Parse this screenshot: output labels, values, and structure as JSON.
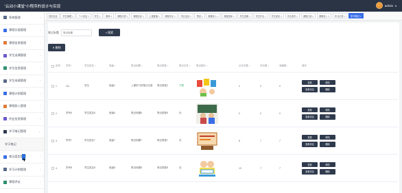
{
  "header": {
    "title": "“云动小课堂”小程序的设计与实现",
    "user": "admin",
    "caret": "▾"
  },
  "sidebar": {
    "items": [
      {
        "label": "系统管理",
        "arrow": "›"
      },
      {
        "label": "课程分类管理",
        "arrow": "›"
      },
      {
        "label": "课程信息管理",
        "arrow": "›"
      },
      {
        "label": "学生选课管理",
        "arrow": "›"
      },
      {
        "label": "学生信息管理",
        "arrow": "›"
      },
      {
        "label": "学生成绩管理",
        "arrow": "›"
      },
      {
        "label": "课程计划管理",
        "arrow": "›"
      },
      {
        "label": "课程收入管理",
        "arrow": "›"
      },
      {
        "label": "作业信息管理",
        "arrow": "›"
      },
      {
        "label": "学习笔记管理",
        "arrow": "⌄"
      },
      {
        "label": "学习笔记",
        "sub": true
      },
      {
        "label": "笔记类型管理",
        "arrow": "›"
      },
      {
        "label": "学习计划管理",
        "arrow": "›"
      },
      {
        "label": "课程评论",
        "arrow": "›"
      },
      {
        "label": "系统管理",
        "arrow": "›"
      }
    ]
  },
  "tabs": [
    {
      "label": "首页信息"
    },
    {
      "label": "学生管理 ×"
    },
    {
      "label": "个人信息 ×"
    },
    {
      "label": "学生 ×"
    },
    {
      "label": "教师 ×"
    },
    {
      "label": "课程分类 ×"
    },
    {
      "label": "课程信息 ×"
    },
    {
      "label": "上课直播 ×"
    },
    {
      "label": "课程评论 ×"
    },
    {
      "label": "作业信息 ×"
    },
    {
      "label": "预设 ×"
    },
    {
      "label": "课程收入 ×"
    },
    {
      "label": "课程选择 ×"
    },
    {
      "label": "学生选课 ×"
    },
    {
      "label": "学生作业 ×"
    },
    {
      "label": "学生成绩 ×"
    },
    {
      "label": "作业收件 ×"
    },
    {
      "label": "课程计划 ×"
    },
    {
      "label": "课程收入 ×"
    },
    {
      "label": "作业记录 ×"
    },
    {
      "label": "学习笔记 ×",
      "active": true
    }
  ],
  "search": {
    "label": "笔记标题",
    "placeholder": "笔记标题",
    "button": "搜索",
    "button_icon": "⌕"
  },
  "delete_button": {
    "label": "删除",
    "icon": "✕"
  },
  "table": {
    "headers": [
      "序号",
      "学号 ↕",
      "学生姓名 ↕",
      "班级 ↕",
      "笔记标题 ↕",
      "笔记类型 ↕",
      "笔记文件 ↕",
      "笔记图片 ↕",
      "点击次数 ↕",
      "评论数 ↕",
      "收藏数 ↕",
      "操作"
    ],
    "rows": [
      {
        "idx": "1",
        "xh": "111",
        "name": "学生",
        "grp": "班级1",
        "title": "上课学习的笔记记录",
        "type": "笔记类型2",
        "file": "下载",
        "click": "2",
        "like": "0",
        "fav": "0"
      },
      {
        "idx": "2",
        "xh": "学号6",
        "name": "学生姓名6",
        "grp": "班级6",
        "title": "笔记标题6",
        "type": "笔记类型6",
        "file": "无",
        "click": "0",
        "like": "0",
        "fav": "0"
      },
      {
        "idx": "3",
        "xh": "学号7",
        "name": "学生姓名7",
        "grp": "班级7",
        "title": "笔记标题7",
        "type": "笔记类型7",
        "file": "无",
        "click": "8",
        "like": "7",
        "fav": "7"
      },
      {
        "idx": "4",
        "xh": "学号8",
        "name": "学生姓名8",
        "grp": "班级8",
        "title": "笔记标题8",
        "type": "笔记类型8",
        "file": "无",
        "click": "10",
        "like": "7",
        "fav": "7"
      }
    ],
    "ops": {
      "view": "查看",
      "edit": "修改",
      "comment": "查看评论",
      "delete": "删除"
    }
  },
  "colors": {
    "topbar": "#2b3445",
    "button": "#2f3a4d",
    "active_tab": "#3a6ee8",
    "file_link": "#3cb371"
  }
}
